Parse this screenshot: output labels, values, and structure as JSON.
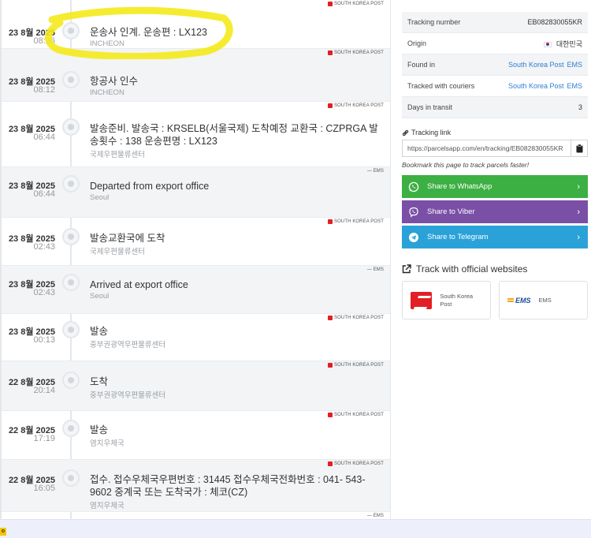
{
  "events": [
    {
      "date": "23 8월 2025",
      "time": "08:36",
      "desc": "운송사 인계. 운송편 : LX123",
      "loc": "INCHEON",
      "badge": "SOUTH KOREA POST",
      "flag": true
    },
    {
      "date": "23 8월 2025",
      "time": "08:12",
      "desc": "항공사 인수",
      "loc": "INCHEON",
      "badge": "SOUTH KOREA POST",
      "flag": true
    },
    {
      "date": "23 8월 2025",
      "time": "06:44",
      "desc": "발송준비. 발송국 : KRSELB(서울국제) 도착예정 교환국 : CZPRGA 발송횟수 : 138 운송편명 : LX123",
      "loc": "국제우편물류센터",
      "badge": "SOUTH KOREA POST",
      "flag": true
    },
    {
      "date": "23 8월 2025",
      "time": "06:44",
      "desc": "Departed from export office",
      "loc": "Seoul",
      "badge": "— EMS",
      "flag": false
    },
    {
      "date": "23 8월 2025",
      "time": "02:43",
      "desc": "발송교환국에 도착",
      "loc": "국제우편물류센터",
      "badge": "SOUTH KOREA POST",
      "flag": true
    },
    {
      "date": "23 8월 2025",
      "time": "02:43",
      "desc": "Arrived at export office",
      "loc": "Seoul",
      "badge": "— EMS",
      "flag": false
    },
    {
      "date": "23 8월 2025",
      "time": "00:13",
      "desc": "발송",
      "loc": "중부권광역우편물류센터",
      "badge": "SOUTH KOREA POST",
      "flag": true
    },
    {
      "date": "22 8월 2025",
      "time": "20:14",
      "desc": "도착",
      "loc": "중부권광역우편물류센터",
      "badge": "SOUTH KOREA POST",
      "flag": true
    },
    {
      "date": "22 8월 2025",
      "time": "17:19",
      "desc": "발송",
      "loc": "염치우체국",
      "badge": "SOUTH KOREA POST",
      "flag": true
    },
    {
      "date": "22 8월 2025",
      "time": "16:05",
      "desc": "접수. 접수우체국우편번호 : 31445 접수우체국전화번호 : 041- 543-9602 중계국 또는 도착국가 : 체코(CZ)",
      "loc": "염치우체국",
      "badge": "SOUTH KOREA POST",
      "flag": true
    },
    {
      "date": "",
      "time": "",
      "desc": "",
      "loc": "",
      "badge": "— EMS",
      "flag": false
    }
  ],
  "info": {
    "tracking_number_label": "Tracking number",
    "tracking_number": "EB082830055KR",
    "origin_label": "Origin",
    "origin": "대한민국",
    "found_in_label": "Found in",
    "found_in_1": "South Korea Post",
    "found_in_2": "EMS",
    "tracked_label": "Tracked with couriers",
    "tracked_1": "South Korea Post",
    "tracked_2": "EMS",
    "days_label": "Days in transit",
    "days": "3"
  },
  "tracking_link": {
    "label": "Tracking link",
    "url": "https://parcelsapp.com/en/tracking/EB082830055KR",
    "bookmark": "Bookmark this page to track parcels faster!"
  },
  "share": {
    "whatsapp": "Share to WhatsApp",
    "viber": "Share to Viber",
    "telegram": "Share to Telegram"
  },
  "official": {
    "title": "Track with official websites",
    "korea_post": "South Korea Post",
    "ems": "EMS",
    "ems_logo": "EMS"
  },
  "bottom": {
    "tag": "o"
  },
  "colors": {
    "whatsapp": "#3cb043",
    "viber": "#7a4fa6",
    "telegram": "#2aa2d8",
    "link": "#2f7fd1",
    "korea_post_red": "#e31e24",
    "highlighter": "#f4ea1b"
  }
}
